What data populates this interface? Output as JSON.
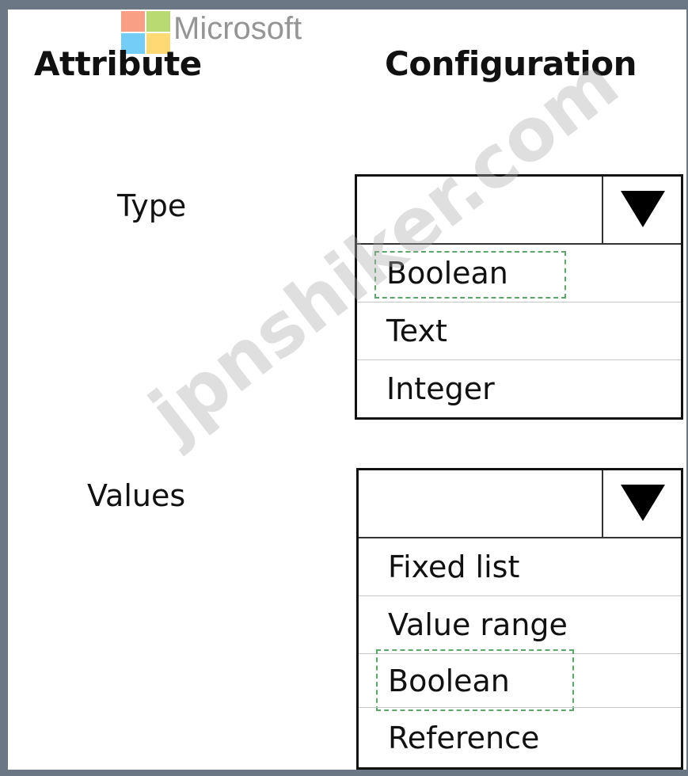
{
  "logo": {
    "label": "Microsoft",
    "colors": [
      "#f25022",
      "#7fba00",
      "#00a4ef",
      "#ffb900"
    ]
  },
  "header": {
    "attribute": "Attribute",
    "configuration": "Configuration"
  },
  "rows": [
    {
      "label": "Type",
      "options": [
        "Boolean",
        "Text",
        "Integer"
      ],
      "selected": "Boolean"
    },
    {
      "label": "Values",
      "options": [
        "Fixed list",
        "Value range",
        "Boolean",
        "Reference"
      ],
      "selected": "Boolean"
    }
  ],
  "watermark": "jpnshiker.com",
  "colors": {
    "frame": "#6b7785",
    "selection_border": "#5ea56c"
  }
}
